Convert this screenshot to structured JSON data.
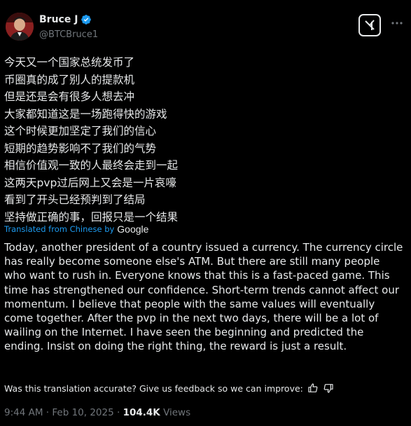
{
  "author": {
    "name": "Bruce J",
    "handle": "@BTCBruce1",
    "verified_color": "#1d9bf0"
  },
  "tweet": {
    "lines": [
      "今天又一个国家总统发币了",
      "币圈真的成了别人的提款机",
      "但是还是会有很多人想去冲",
      "大家都知道这是一场跑得快的游戏",
      "这个时候更加坚定了我们的信心",
      "短期的趋势影响不了我们的气势",
      "相信价值观一致的人最终会走到一起",
      "这两天pvp过后网上又会是一片哀嚎",
      "看到了开头已经预判到了结局",
      "坚持做正确的事，回报只是一个结果"
    ],
    "translated_label": "Translated from Chinese by",
    "translator": "Google",
    "translation": "Today, another president of a country issued a currency. The currency circle has really become someone else's ATM. But there are still many people who want to rush in. Everyone knows that this is a fast-paced game. This time has strengthened our confidence. Short-term trends cannot affect our momentum. I believe that people with the same values will eventually come together. After the pvp in the next two days, there will be a lot of wailing on the Internet. I have seen the beginning and predicted the ending. Insist on doing the right thing, the reward is just a result.",
    "feedback_prompt": "Was this translation accurate? Give us feedback so we can improve:",
    "time": "9:44 AM",
    "separator": "·",
    "date": "Feb 10, 2025",
    "views_count": "104.4K",
    "views_label": "Views"
  },
  "icons": {
    "verified": "verified-badge-icon",
    "grok": "grok-icon",
    "more": "more-icon",
    "thumbs_up": "thumbs-up-icon",
    "thumbs_down": "thumbs-down-icon"
  },
  "colors": {
    "background": "#000000",
    "text": "#e7e9ea",
    "secondary": "#71767b",
    "link": "#1d9bf0"
  }
}
